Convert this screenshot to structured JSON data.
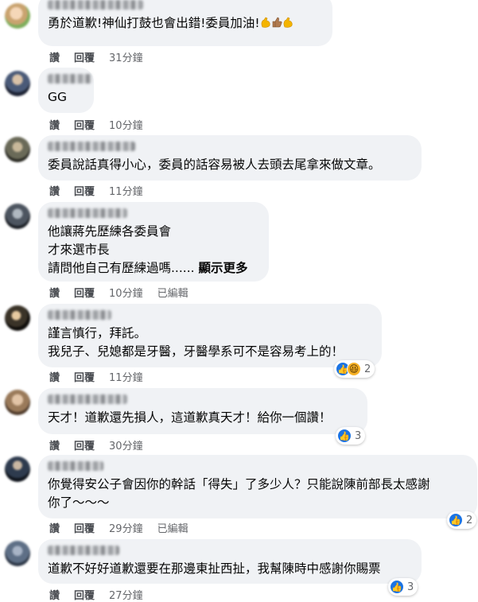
{
  "comments": [
    {
      "text": "勇於道歉!神仙打鼓也會出錯!委員加油!",
      "emojis": [
        "flexed-biceps",
        "thumbs-up",
        "flexed-biceps"
      ],
      "actions": {
        "like": "讚",
        "reply": "回覆",
        "time": "31分鐘"
      }
    },
    {
      "text": "GG",
      "actions": {
        "like": "讚",
        "reply": "回覆",
        "time": "10分鐘"
      }
    },
    {
      "text": "委員說話真得小心，委員的話容易被人去頭去尾拿來做文章。",
      "actions": {
        "like": "讚",
        "reply": "回覆",
        "time": "11分鐘"
      }
    },
    {
      "text": "他讓蔣先歷練各委員會\n才來選市長\n請問他自己有歷練過嗎......",
      "more": "顯示更多",
      "actions": {
        "like": "讚",
        "reply": "回覆",
        "time": "10分鐘",
        "edited": "已編輯"
      }
    },
    {
      "text": "謹言慎行，拜託。\n我兒子、兒媳都是牙醫，牙醫學系可不是容易考上的！",
      "actions": {
        "like": "讚",
        "reply": "回覆",
        "time": "11分鐘"
      },
      "reactions": {
        "types": [
          "like",
          "haha"
        ],
        "count": "2"
      }
    },
    {
      "text": "天才！道歉還先損人，這道歉真天才！給你一個讚！",
      "actions": {
        "like": "讚",
        "reply": "回覆",
        "time": "30分鐘"
      },
      "reactions": {
        "types": [
          "like"
        ],
        "count": "3"
      }
    },
    {
      "text": "你覺得安公子會因你的幹話「得失」了多少人？只能說陳前部長太感謝\n你了～～～",
      "actions": {
        "like": "讚",
        "reply": "回覆",
        "time": "29分鐘",
        "edited": "已編輯"
      },
      "reactions": {
        "types": [
          "like"
        ],
        "count": "2"
      }
    },
    {
      "text": "道歉不好好道歉還要在那邊東扯西扯，我幫陳時中感謝你賜票",
      "actions": {
        "like": "讚",
        "reply": "回覆",
        "time": "27分鐘"
      },
      "reactions": {
        "types": [
          "like"
        ],
        "count": "3"
      }
    }
  ],
  "colors": {
    "bubble": "#f0f2f5",
    "like": "#1b74e4",
    "haha": "#f7b125",
    "meta": "#65676b"
  }
}
